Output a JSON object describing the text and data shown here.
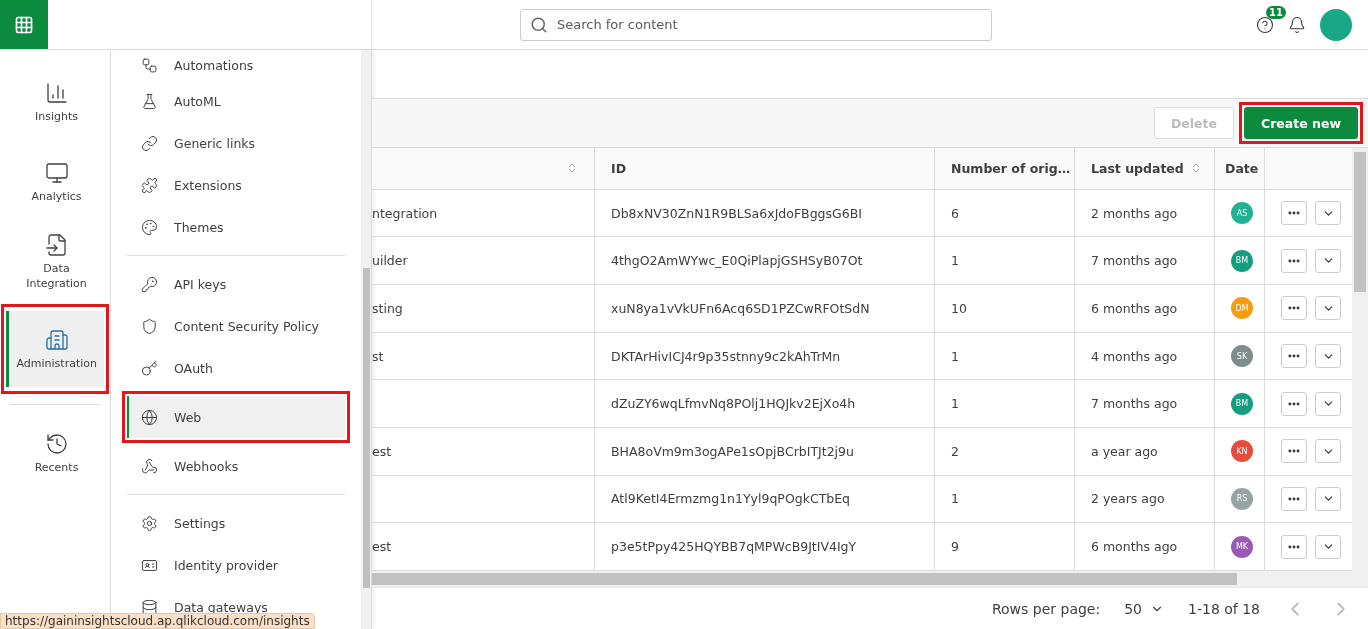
{
  "header": {
    "search": {
      "placeholder": "Search for content"
    },
    "help_badge": "11"
  },
  "rail": {
    "items": [
      {
        "label": "Insights",
        "selected": false
      },
      {
        "label": "Analytics",
        "selected": false
      },
      {
        "label": "Data Integration",
        "selected": false
      },
      {
        "label": "Administration",
        "selected": true,
        "highlighted": true
      }
    ],
    "bottom_items": [
      {
        "label": "Recents",
        "selected": false
      }
    ]
  },
  "menu": {
    "groups": [
      [
        {
          "label": "Automations",
          "selected": false
        },
        {
          "label": "AutoML",
          "selected": false
        },
        {
          "label": "Generic links",
          "selected": false
        },
        {
          "label": "Extensions",
          "selected": false
        },
        {
          "label": "Themes",
          "selected": false
        }
      ],
      [
        {
          "label": "API keys",
          "selected": false
        },
        {
          "label": "Content Security Policy",
          "selected": false
        },
        {
          "label": "OAuth",
          "selected": false
        },
        {
          "label": "Web",
          "selected": true,
          "highlighted": true
        },
        {
          "label": "Webhooks",
          "selected": false
        }
      ],
      [
        {
          "label": "Settings",
          "selected": false
        },
        {
          "label": "Identity provider",
          "selected": false
        },
        {
          "label": "Data gateways",
          "selected": false
        }
      ]
    ]
  },
  "toolbar": {
    "buttons": [
      {
        "label": "Delete",
        "kind": "secondary",
        "disabled": true
      },
      {
        "label": "Create new",
        "kind": "primary",
        "highlighted": true
      }
    ]
  },
  "table": {
    "columns": [
      {
        "sortable": true
      },
      {
        "label": "ID"
      },
      {
        "label": "Number of orig…"
      },
      {
        "label": "Last updated",
        "sortable": true
      },
      {
        "label": "Date"
      }
    ],
    "rows": [
      {
        "col_1": "ntegration",
        "id": "Db8xNV30ZnN1R9BLSa6xJdoFBggsG6BI",
        "count": "6",
        "updated": "2 months ago",
        "owner": "AS",
        "color": "#1fb394"
      },
      {
        "col_1": "uilder",
        "id": "4thgO2AmWYwc_E0QiPlapjGSHSyB07Ot",
        "count": "1",
        "updated": "7 months ago",
        "owner": "BM",
        "color": "#139e7f"
      },
      {
        "col_1": "sting",
        "id": "xuN8ya1vVkUFn6Acq6SD1PZCwRFOtSdN",
        "count": "10",
        "updated": "6 months ago",
        "owner": "DM",
        "color": "#f59c12"
      },
      {
        "col_1": "st",
        "id": "DKTArHivICJ4r9p35stnny9c2kAhTrMn",
        "count": "1",
        "updated": "4 months ago",
        "owner": "SK",
        "color": "#7f8c8d"
      },
      {
        "id": "dZuZY6wqLfmvNq8POlj1HQJkv2EjXo4h",
        "count": "1",
        "updated": "7 months ago",
        "owner": "BM",
        "color": "#139e7f"
      },
      {
        "col_1": "est",
        "id": "BHA8oVm9m3ogAPe1sOpjBCrbITJt2j9u",
        "count": "2",
        "updated": "a year ago",
        "owner": "KN",
        "color": "#e74c3c"
      },
      {
        "id": "Atl9KetI4Ermzmg1n1Yyl9qPOgkCTbEq",
        "count": "1",
        "updated": "2 years ago",
        "owner": "RS",
        "color": "#95a5a6"
      },
      {
        "col_1": "est",
        "id": "p3e5tPpy425HQYBB7qMPWcB9JtIV4IgY",
        "count": "9",
        "updated": "6 months ago",
        "owner": "MK",
        "color": "#9b59b6"
      }
    ]
  },
  "pagination": {
    "rows_per_page_label": "Rows per page:",
    "rows_per_page": "50",
    "range": "1-18 of 18"
  },
  "status_url": "https://gaininsightscloud.ap.qlikcloud.com/insights"
}
